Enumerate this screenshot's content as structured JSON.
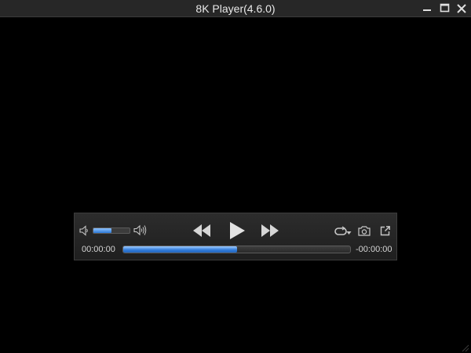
{
  "window": {
    "title": "8K Player(4.6.0)",
    "controls": [
      "minimize-icon",
      "maximize-icon",
      "close-icon"
    ]
  },
  "player": {
    "volume_level": 0.5,
    "progress_level": 0.5,
    "time_elapsed": "00:00:00",
    "time_remaining": "-00:00:00",
    "icons": {
      "volume_low": "speaker-low-icon",
      "volume_high": "speaker-high-icon",
      "rewind": "rewind-icon",
      "play": "play-icon",
      "forward": "fast-forward-icon",
      "loop": "loop-icon",
      "snapshot": "camera-icon",
      "popout": "popout-icon"
    }
  },
  "colors": {
    "titlebar": "#272727",
    "background": "#000000",
    "accent": "#2c78d6",
    "icon": "#c8c8c8"
  }
}
